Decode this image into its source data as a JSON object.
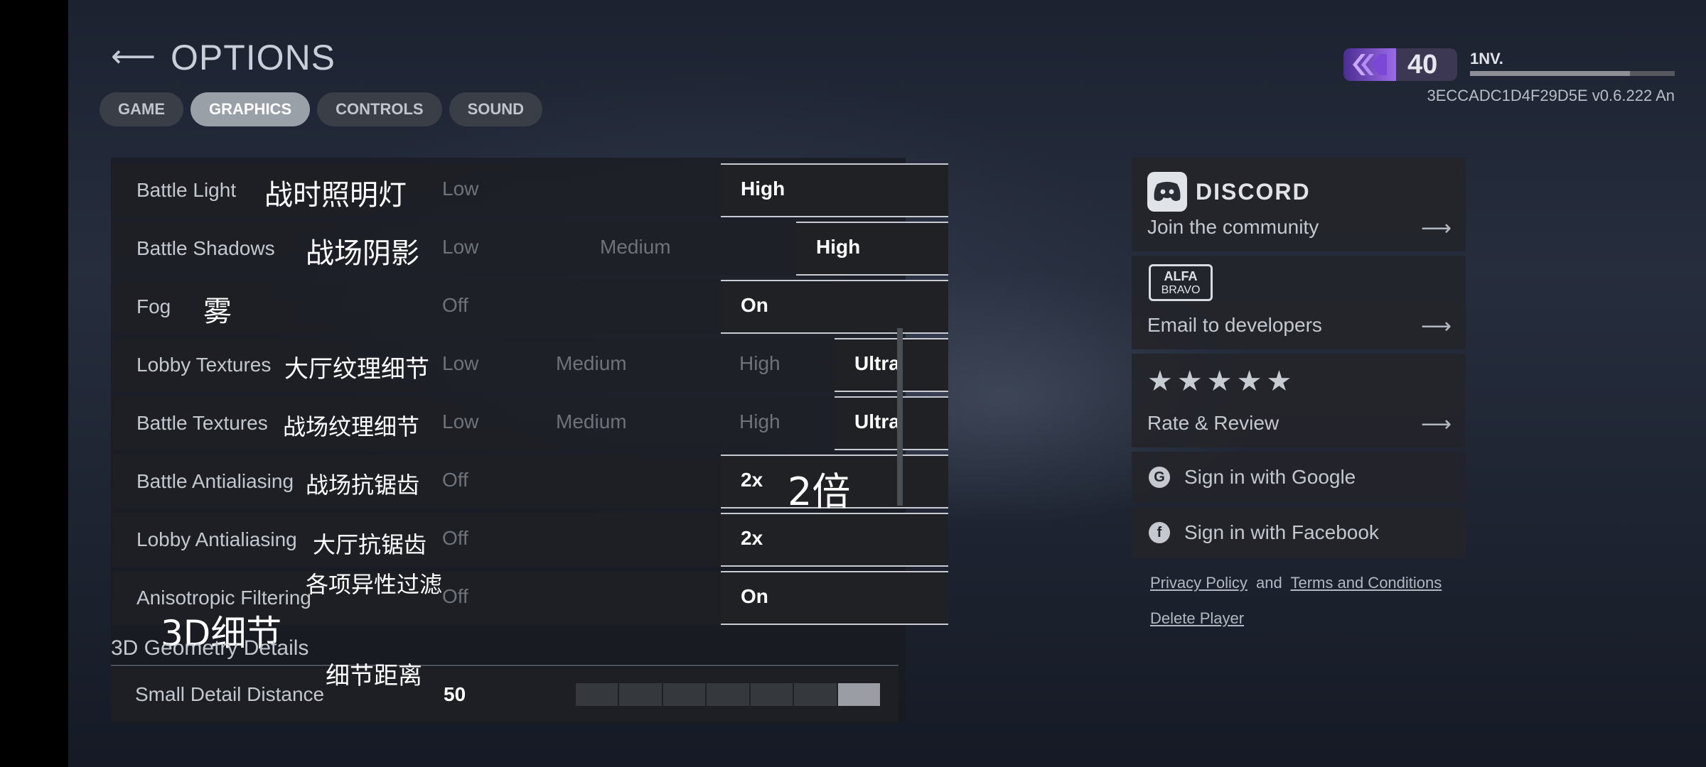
{
  "header": {
    "back_arrow": "⟵",
    "title": "OPTIONS",
    "tabs": [
      {
        "label": "GAME"
      },
      {
        "label": "GRAPHICS"
      },
      {
        "label": "CONTROLS"
      },
      {
        "label": "SOUND"
      }
    ],
    "active_tab": "GRAPHICS"
  },
  "player": {
    "level": "40",
    "name": "1NV.",
    "xp_progress": 0.78,
    "build_id": "3ECCADC1D4F29D5E v0.6.222 An"
  },
  "graphics": {
    "rows": [
      {
        "label": "Battle Light",
        "cn": "战时照明灯",
        "options": [
          "Low",
          "High"
        ],
        "selected": "High"
      },
      {
        "label": "Battle Shadows",
        "cn": "战场阴影",
        "options": [
          "Low",
          "Medium",
          "High"
        ],
        "selected": "High"
      },
      {
        "label": "Fog",
        "cn": "雾",
        "options": [
          "Off",
          "On"
        ],
        "selected": "On"
      },
      {
        "label": "Lobby Textures",
        "cn": "大厅纹理细节",
        "options": [
          "Low",
          "Medium",
          "High",
          "Ultra"
        ],
        "selected": "Ultra"
      },
      {
        "label": "Battle Textures",
        "cn": "战场纹理细节",
        "options": [
          "Low",
          "Medium",
          "High",
          "Ultra"
        ],
        "selected": "Ultra"
      },
      {
        "label": "Battle Antialiasing",
        "cn": "战场抗锯齿",
        "options": [
          "Off",
          "2x"
        ],
        "selected": "2x",
        "cn_extra": "2倍"
      },
      {
        "label": "Lobby Antialiasing",
        "cn": "大厅抗锯齿",
        "options": [
          "Off",
          "2x"
        ],
        "selected": "2x"
      },
      {
        "label": "Anisotropic Filtering",
        "cn": "各项异性过滤",
        "options": [
          "Off",
          "On"
        ],
        "selected": "On"
      }
    ],
    "section": {
      "title": "3D Geometry Details",
      "cn": "3D细节"
    },
    "slider": {
      "label": "Small Detail Distance",
      "cn": "细节距离",
      "value": "50",
      "segments": 7,
      "filled_segment": 7
    }
  },
  "social": {
    "discord": {
      "logo_text": "DISCORD",
      "caption": "Join the community",
      "arrow": "⟶"
    },
    "email": {
      "logo_line1": "ALFA",
      "logo_line2": "BRAVO",
      "caption": "Email to developers",
      "arrow": "⟶"
    },
    "rate": {
      "stars": "★★★★★",
      "caption": "Rate & Review",
      "arrow": "⟶"
    },
    "google": {
      "icon": "G",
      "caption": "Sign in with Google"
    },
    "facebook": {
      "icon": "f",
      "caption": "Sign in with Facebook"
    },
    "privacy": "Privacy Policy",
    "and": "and",
    "terms": "Terms and Conditions",
    "delete": "Delete Player"
  },
  "colors": {
    "accent_rank": "#9c6be8",
    "selected_bg": "#1f2125",
    "tab_active": "#9aa0a8"
  }
}
